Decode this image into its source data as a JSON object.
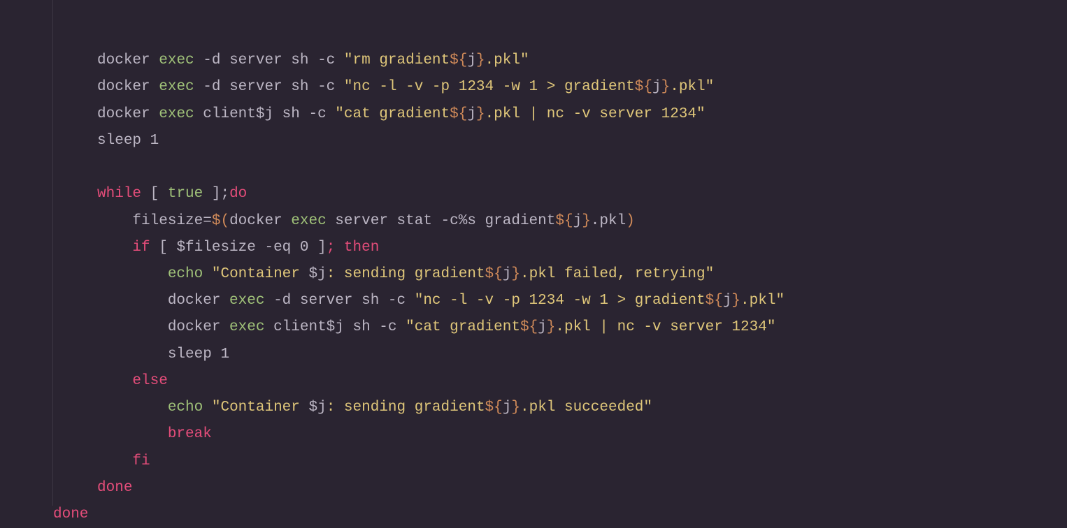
{
  "lines": [
    [
      {
        "indent": 5,
        "cls": "t-default",
        "text": "docker "
      },
      {
        "cls": "t-green",
        "text": "exec"
      },
      {
        "cls": "t-default",
        "text": " -d server sh -c "
      },
      {
        "cls": "t-yellow",
        "text": "\"rm gradient"
      },
      {
        "cls": "t-orange",
        "text": "${"
      },
      {
        "cls": "t-default",
        "text": "j"
      },
      {
        "cls": "t-orange",
        "text": "}"
      },
      {
        "cls": "t-yellow",
        "text": ".pkl\""
      }
    ],
    [
      {
        "indent": 5,
        "cls": "t-default",
        "text": "docker "
      },
      {
        "cls": "t-green",
        "text": "exec"
      },
      {
        "cls": "t-default",
        "text": " -d server sh -c "
      },
      {
        "cls": "t-yellow",
        "text": "\"nc -l -v -p 1234 -w 1 > gradient"
      },
      {
        "cls": "t-orange",
        "text": "${"
      },
      {
        "cls": "t-default",
        "text": "j"
      },
      {
        "cls": "t-orange",
        "text": "}"
      },
      {
        "cls": "t-yellow",
        "text": ".pkl\""
      }
    ],
    [
      {
        "indent": 5,
        "cls": "t-default",
        "text": "docker "
      },
      {
        "cls": "t-green",
        "text": "exec"
      },
      {
        "cls": "t-default",
        "text": " client$j sh -c "
      },
      {
        "cls": "t-yellow",
        "text": "\"cat gradient"
      },
      {
        "cls": "t-orange",
        "text": "${"
      },
      {
        "cls": "t-default",
        "text": "j"
      },
      {
        "cls": "t-orange",
        "text": "}"
      },
      {
        "cls": "t-yellow",
        "text": ".pkl | nc -v server 1234\""
      }
    ],
    [
      {
        "indent": 5,
        "cls": "t-default",
        "text": "sleep 1"
      }
    ],
    [
      {
        "indent": 0,
        "cls": "t-default",
        "text": ""
      }
    ],
    [
      {
        "indent": 5,
        "cls": "t-pink",
        "text": "while"
      },
      {
        "cls": "t-default",
        "text": " [ "
      },
      {
        "cls": "t-green",
        "text": "true"
      },
      {
        "cls": "t-default",
        "text": " ];"
      },
      {
        "cls": "t-pink",
        "text": "do"
      }
    ],
    [
      {
        "indent": 9,
        "cls": "t-default",
        "text": "filesize="
      },
      {
        "cls": "t-orange",
        "text": "$("
      },
      {
        "cls": "t-default",
        "text": "docker "
      },
      {
        "cls": "t-green",
        "text": "exec"
      },
      {
        "cls": "t-default",
        "text": " server stat -c%s gradient"
      },
      {
        "cls": "t-orange",
        "text": "${"
      },
      {
        "cls": "t-default",
        "text": "j"
      },
      {
        "cls": "t-orange",
        "text": "}"
      },
      {
        "cls": "t-default",
        "text": ".pkl"
      },
      {
        "cls": "t-orange",
        "text": ")"
      }
    ],
    [
      {
        "indent": 9,
        "cls": "t-pink",
        "text": "if"
      },
      {
        "cls": "t-default",
        "text": " [ $filesize -eq 0 ]"
      },
      {
        "cls": "t-pink",
        "text": ";"
      },
      {
        "cls": "t-default",
        "text": " "
      },
      {
        "cls": "t-pink",
        "text": "then"
      }
    ],
    [
      {
        "indent": 13,
        "cls": "t-green",
        "text": "echo"
      },
      {
        "cls": "t-default",
        "text": " "
      },
      {
        "cls": "t-yellow",
        "text": "\"Container "
      },
      {
        "cls": "t-default",
        "text": "$j"
      },
      {
        "cls": "t-yellow",
        "text": ": sending gradient"
      },
      {
        "cls": "t-orange",
        "text": "${"
      },
      {
        "cls": "t-default",
        "text": "j"
      },
      {
        "cls": "t-orange",
        "text": "}"
      },
      {
        "cls": "t-yellow",
        "text": ".pkl failed, retrying\""
      }
    ],
    [
      {
        "indent": 13,
        "cls": "t-default",
        "text": "docker "
      },
      {
        "cls": "t-green",
        "text": "exec"
      },
      {
        "cls": "t-default",
        "text": " -d server sh -c "
      },
      {
        "cls": "t-yellow",
        "text": "\"nc -l -v -p 1234 -w 1 > gradient"
      },
      {
        "cls": "t-orange",
        "text": "${"
      },
      {
        "cls": "t-default",
        "text": "j"
      },
      {
        "cls": "t-orange",
        "text": "}"
      },
      {
        "cls": "t-yellow",
        "text": ".pkl\""
      }
    ],
    [
      {
        "indent": 13,
        "cls": "t-default",
        "text": "docker "
      },
      {
        "cls": "t-green",
        "text": "exec"
      },
      {
        "cls": "t-default",
        "text": " client$j sh -c "
      },
      {
        "cls": "t-yellow",
        "text": "\"cat gradient"
      },
      {
        "cls": "t-orange",
        "text": "${"
      },
      {
        "cls": "t-default",
        "text": "j"
      },
      {
        "cls": "t-orange",
        "text": "}"
      },
      {
        "cls": "t-yellow",
        "text": ".pkl | nc -v server 1234\""
      }
    ],
    [
      {
        "indent": 13,
        "cls": "t-default",
        "text": "sleep 1"
      }
    ],
    [
      {
        "indent": 9,
        "cls": "t-pink",
        "text": "else"
      }
    ],
    [
      {
        "indent": 13,
        "cls": "t-green",
        "text": "echo"
      },
      {
        "cls": "t-default",
        "text": " "
      },
      {
        "cls": "t-yellow",
        "text": "\"Container "
      },
      {
        "cls": "t-default",
        "text": "$j"
      },
      {
        "cls": "t-yellow",
        "text": ": sending gradient"
      },
      {
        "cls": "t-orange",
        "text": "${"
      },
      {
        "cls": "t-default",
        "text": "j"
      },
      {
        "cls": "t-orange",
        "text": "}"
      },
      {
        "cls": "t-yellow",
        "text": ".pkl succeeded\""
      }
    ],
    [
      {
        "indent": 13,
        "cls": "t-pink",
        "text": "break"
      }
    ],
    [
      {
        "indent": 9,
        "cls": "t-pink",
        "text": "fi"
      }
    ],
    [
      {
        "indent": 5,
        "cls": "t-pink",
        "text": "done"
      }
    ],
    [
      {
        "indent": 0,
        "cls": "t-pink",
        "text": "done"
      }
    ]
  ]
}
